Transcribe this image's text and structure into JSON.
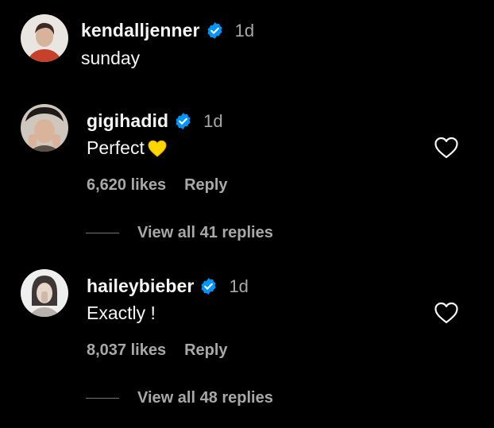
{
  "caption": {
    "username": "kendalljenner",
    "time": "1d",
    "text": "sunday",
    "verified_icon": "verified-badge-icon"
  },
  "comments": [
    {
      "username": "gigihadid",
      "time": "1d",
      "text": "Perfect",
      "emoji": "yellow-heart-emoji",
      "likes": "6,620 likes",
      "reply_label": "Reply",
      "view_replies": "View all 41 replies",
      "verified_icon": "verified-badge-icon",
      "like_icon": "heart-outline-icon"
    },
    {
      "username": "haileybieber",
      "time": "1d",
      "text": "Exactly !",
      "likes": "8,037 likes",
      "reply_label": "Reply",
      "view_replies": "View all 48 replies",
      "verified_icon": "verified-badge-icon",
      "like_icon": "heart-outline-icon"
    }
  ],
  "colors": {
    "background": "#000000",
    "primary_text": "#f5f5f5",
    "secondary_text": "#a8a8a8",
    "verified_blue": "#0095f6",
    "emoji_yellow": "#ffd700"
  }
}
